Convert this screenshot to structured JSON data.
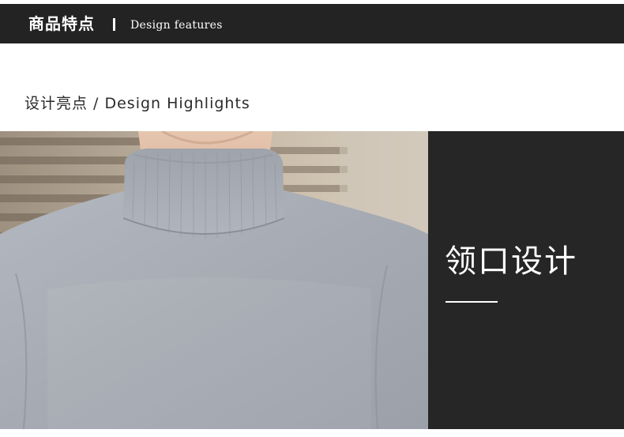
{
  "banner": {
    "title": "商品特点",
    "subtitle": "Design features"
  },
  "section": {
    "heading": "设计亮点 / Design Highlights"
  },
  "photo": {
    "subject": "man-wearing-grey-mock-neck-sweater"
  },
  "feature": {
    "title": "领口设计"
  },
  "colors": {
    "banner_bg": "#232323",
    "panel_bg": "#262626",
    "sweater": "#a6aab2",
    "text_dark": "#2a2a2a",
    "text_light": "#ffffff"
  }
}
